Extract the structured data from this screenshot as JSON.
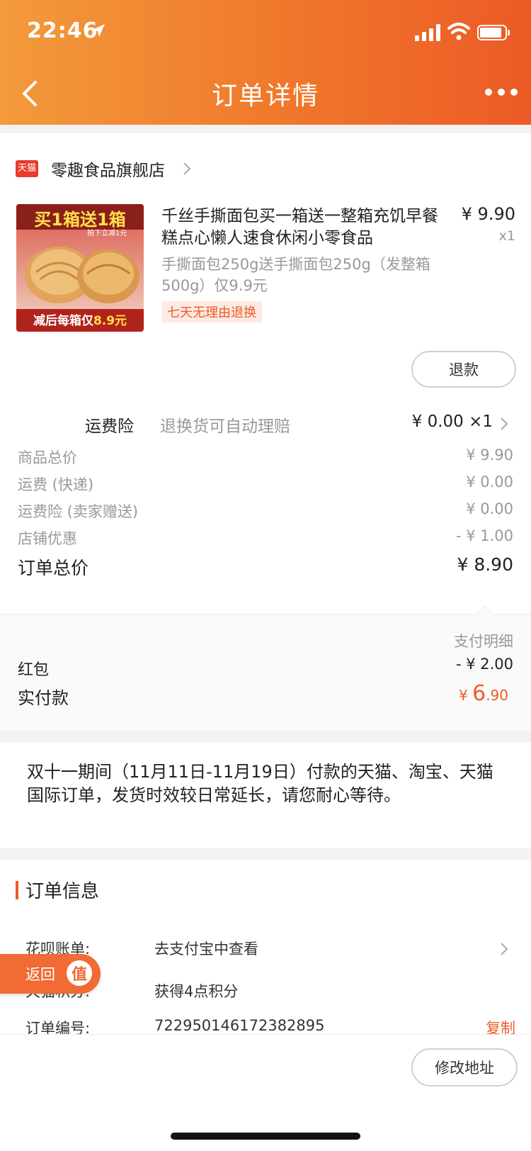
{
  "status_bar": {
    "time": "22:46"
  },
  "header": {
    "title": "订单详情"
  },
  "store": {
    "badge": "天猫",
    "name": "零趣食品旗舰店"
  },
  "product": {
    "image_banner_top": "买1箱送1箱",
    "image_banner_sub": "拍下立减1元",
    "image_banner_bottom_prefix": "减后每箱仅",
    "image_banner_bottom_price": "8.9元",
    "title": "千丝手撕面包买一箱送一整箱充饥早餐糕点心懒人速食休闲小零食品",
    "price": "¥ 9.90",
    "qty": "x1",
    "spec": "手撕面包250g送手撕面包250g（发整箱500g）仅9.9元",
    "return_tag": "七天无理由退换",
    "refund_button": "退款"
  },
  "insurance": {
    "label": "运费险",
    "desc": "退换货可自动理赔",
    "price": "¥ 0.00 ×1"
  },
  "price_rows": [
    {
      "label": "商品总价",
      "value": "¥ 9.90"
    },
    {
      "label": "运费 (快递)",
      "value": "¥ 0.00"
    },
    {
      "label": "运费险 (卖家赠送)",
      "value": "¥ 0.00"
    },
    {
      "label": "店铺优惠",
      "value": "- ¥ 1.00"
    }
  ],
  "order_total": {
    "label": "订单总价",
    "value": "¥ 8.90"
  },
  "payment": {
    "detail_label": "支付明细",
    "hongbao_label": "红包",
    "hongbao_value": "- ¥ 2.00",
    "paid_label": "实付款",
    "paid_symbol": "¥ ",
    "paid_int": "6",
    "paid_dec": ".90"
  },
  "notice": {
    "text": "双十一期间（11月11日-11月19日）付款的天猫、淘宝、天猫国际订单，发货时效较日常延长，请您耐心等待。"
  },
  "order_info": {
    "title": "订单信息",
    "rows": [
      {
        "key": "花呗账单:",
        "value": "去支付宝中查看"
      },
      {
        "key": "天猫积分:",
        "value": "获得4点积分"
      },
      {
        "key": "订单编号:",
        "value": "722950146172382895"
      }
    ],
    "copy_label": "复制",
    "modify_button": "修改地址"
  },
  "float_button": {
    "label": "返回",
    "badge": "值"
  },
  "colors": {
    "accent": "#f05a28",
    "header_start": "#f39a3c",
    "header_end": "#ec5a26"
  }
}
